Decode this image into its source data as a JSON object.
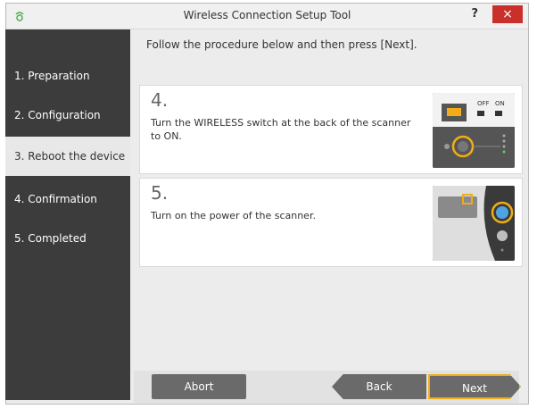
{
  "window": {
    "title": "Wireless Connection Setup Tool",
    "help_symbol": "?",
    "close_symbol": "×"
  },
  "sidebar": {
    "items": [
      {
        "label": "1. Preparation"
      },
      {
        "label": "2. Configuration"
      },
      {
        "label": "3. Reboot the device"
      },
      {
        "label": "4. Confirmation"
      },
      {
        "label": "5. Completed"
      }
    ],
    "active_index": 2
  },
  "content": {
    "instruction": "Follow the procedure below and then press [Next].",
    "steps": [
      {
        "number": "4.",
        "text": "Turn the WIRELESS switch at the back of the scanner to ON.",
        "image_labels": {
          "off": "OFF",
          "on": "ON"
        }
      },
      {
        "number": "5.",
        "text": "Turn on the power of the scanner."
      }
    ]
  },
  "footer": {
    "abort_label": "Abort",
    "back_label": "Back",
    "next_label": "Next"
  },
  "colors": {
    "sidebar_bg": "#3c3c3c",
    "active_bg": "#e8e8e8",
    "highlight": "#f0ad1a",
    "close_bg": "#c9302c"
  }
}
